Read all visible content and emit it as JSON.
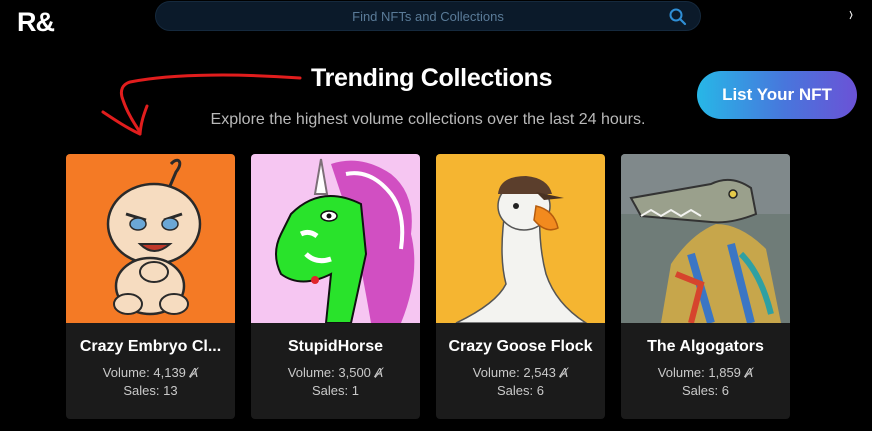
{
  "header": {
    "logo_text": "R&",
    "search_placeholder": "Find NFTs and Collections"
  },
  "main": {
    "title": "Trending Collections",
    "subtitle": "Explore the highest volume collections over the last 24 hours.",
    "list_button_label": "List Your NFT",
    "currency_symbol": "Ⱥ",
    "collections": [
      {
        "name": "Crazy Embryo Cl...",
        "volume_label": "Volume: 4,139",
        "sales_label": "Sales: 13",
        "image": "crazy-embryo-art",
        "bg_color": "#f47a25"
      },
      {
        "name": "StupidHorse",
        "volume_label": "Volume: 3,500",
        "sales_label": "Sales: 1",
        "image": "stupid-horse-art",
        "bg_color": "#f6c6f2"
      },
      {
        "name": "Crazy Goose Flock",
        "volume_label": "Volume: 2,543",
        "sales_label": "Sales: 6",
        "image": "crazy-goose-art",
        "bg_color": "#f5b531"
      },
      {
        "name": "The Algogators",
        "volume_label": "Volume: 1,859",
        "sales_label": "Sales: 6",
        "image": "algogators-art",
        "bg_color": "#6f7c78"
      }
    ]
  },
  "colors": {
    "background": "#000000",
    "search_bg": "#0b1a2a",
    "accent_gradient_start": "#27b7e7",
    "accent_gradient_end": "#6b52d6",
    "card_bg": "#1b1b1b",
    "annotation_arrow": "#e11d1d"
  }
}
